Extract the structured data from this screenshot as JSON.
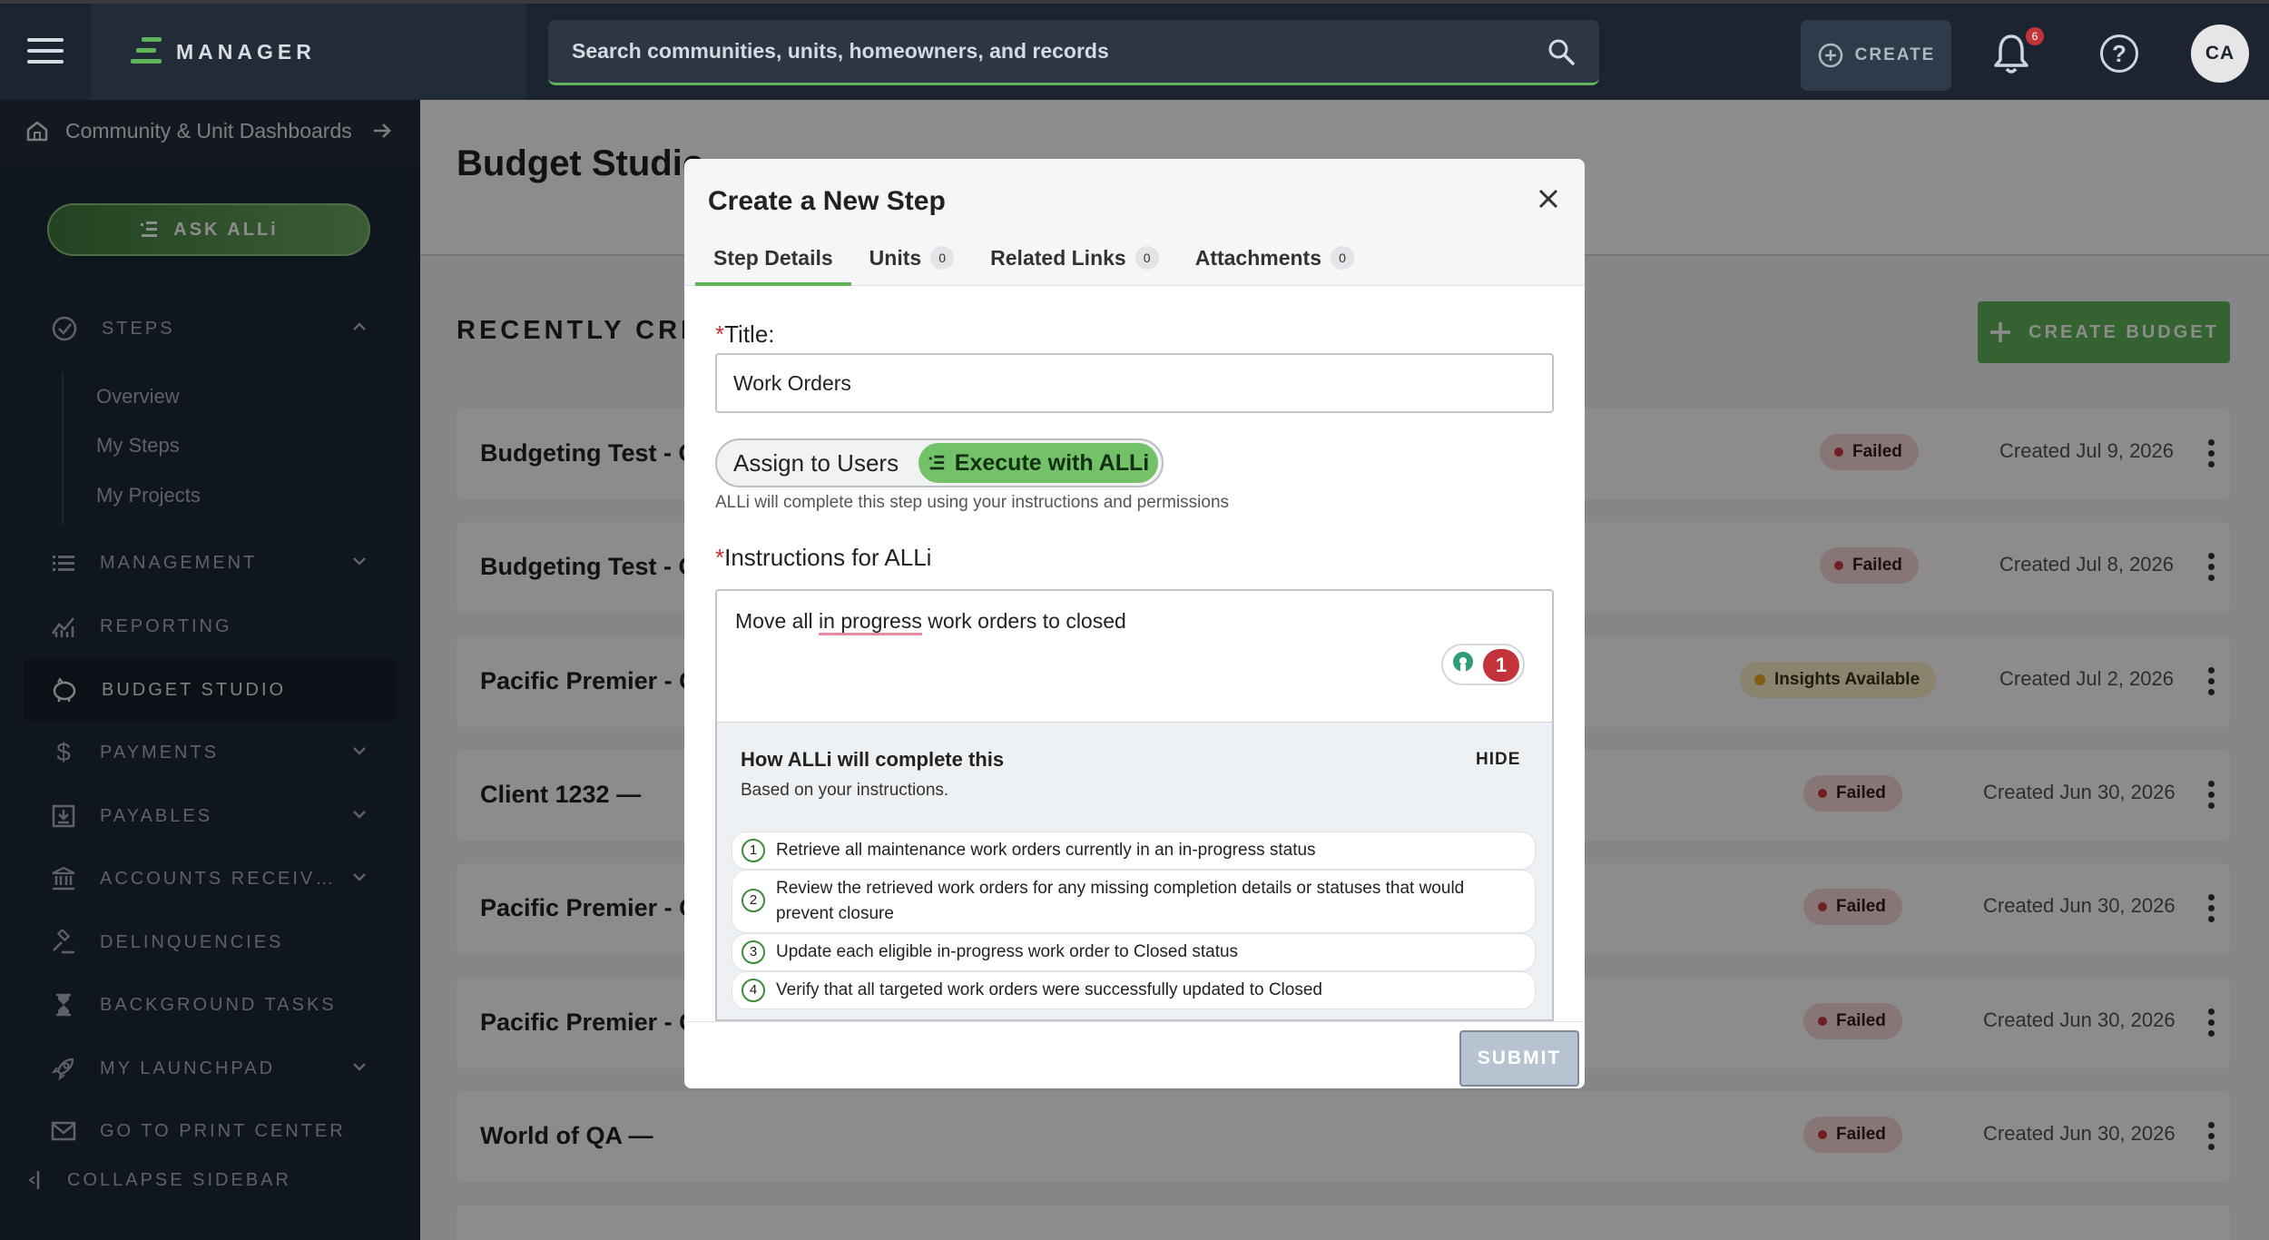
{
  "topbar": {
    "logo": "MANAGER",
    "search_placeholder": "Search communities, units, homeowners, and records",
    "create_label": "CREATE",
    "notification_count": "6",
    "avatar_initials": "CA"
  },
  "sidebar": {
    "dashboards_link": "Community & Unit Dashboards",
    "ask_alli": "ASK ALLi",
    "steps": "STEPS",
    "sub_items": [
      "Overview",
      "My Steps",
      "My Projects"
    ],
    "items": [
      "MANAGEMENT",
      "REPORTING",
      "BUDGET STUDIO",
      "PAYMENTS",
      "PAYABLES",
      "ACCOUNTS RECEIV…",
      "DELINQUENCIES",
      "BACKGROUND TASKS",
      "MY LAUNCHPAD",
      "GO TO PRINT CENTER"
    ],
    "collapse": "COLLAPSE SIDEBAR"
  },
  "main": {
    "page_title": "Budget Studio",
    "recent_title": "RECENTLY CREA",
    "create_budget": "CREATE BUDGET",
    "rows": [
      {
        "name": "Budgeting Test - C",
        "status": "Failed",
        "date": "Created Jul 9, 2026"
      },
      {
        "name": "Budgeting Test - C",
        "status": "Failed",
        "date": "Created Jul 8, 2026"
      },
      {
        "name": "Pacific Premier - C",
        "status": "Insights Available",
        "date": "Created Jul 2, 2026"
      },
      {
        "name": "Client 1232 —",
        "status": "Failed",
        "date": "Created Jun 30, 2026"
      },
      {
        "name": "Pacific Premier - C",
        "status": "Failed",
        "date": "Created Jun 30, 2026"
      },
      {
        "name": "Pacific Premier - C",
        "status": "Failed",
        "date": "Created Jun 30, 2026"
      },
      {
        "name": "World of QA —",
        "status": "Failed",
        "date": "Created Jun 30, 2026"
      }
    ]
  },
  "modal": {
    "title": "Create a New Step",
    "tabs": [
      {
        "label": "Step Details",
        "count": ""
      },
      {
        "label": "Units",
        "count": "0"
      },
      {
        "label": "Related Links",
        "count": "0"
      },
      {
        "label": "Attachments",
        "count": "0"
      }
    ],
    "title_label": "Title:",
    "title_value": "Work Orders",
    "assign_users": "Assign to Users",
    "execute_alli": "Execute with ALLi",
    "helper": "ALLi will complete this step using your instructions and permissions",
    "instructions_label": "Instructions for ALLi",
    "instructions_before": "Move all ",
    "instructions_marked": "in progress",
    "instructions_after": " work orders to closed",
    "grammar_count": "1",
    "plan_title": "How ALLi will complete this",
    "plan_sub": "Based on your instructions.",
    "plan_hide": "HIDE",
    "plan_steps": [
      {
        "num": "1",
        "text": "Retrieve all maintenance work orders currently in an in-progress status"
      },
      {
        "num": "2",
        "text": "Review the retrieved work orders for any missing completion details or statuses that would prevent closure"
      },
      {
        "num": "3",
        "text": "Update each eligible in-progress work order to Closed status"
      },
      {
        "num": "4",
        "text": "Verify that all targeted work orders were successfully updated to Closed"
      }
    ],
    "submit": "SUBMIT"
  }
}
